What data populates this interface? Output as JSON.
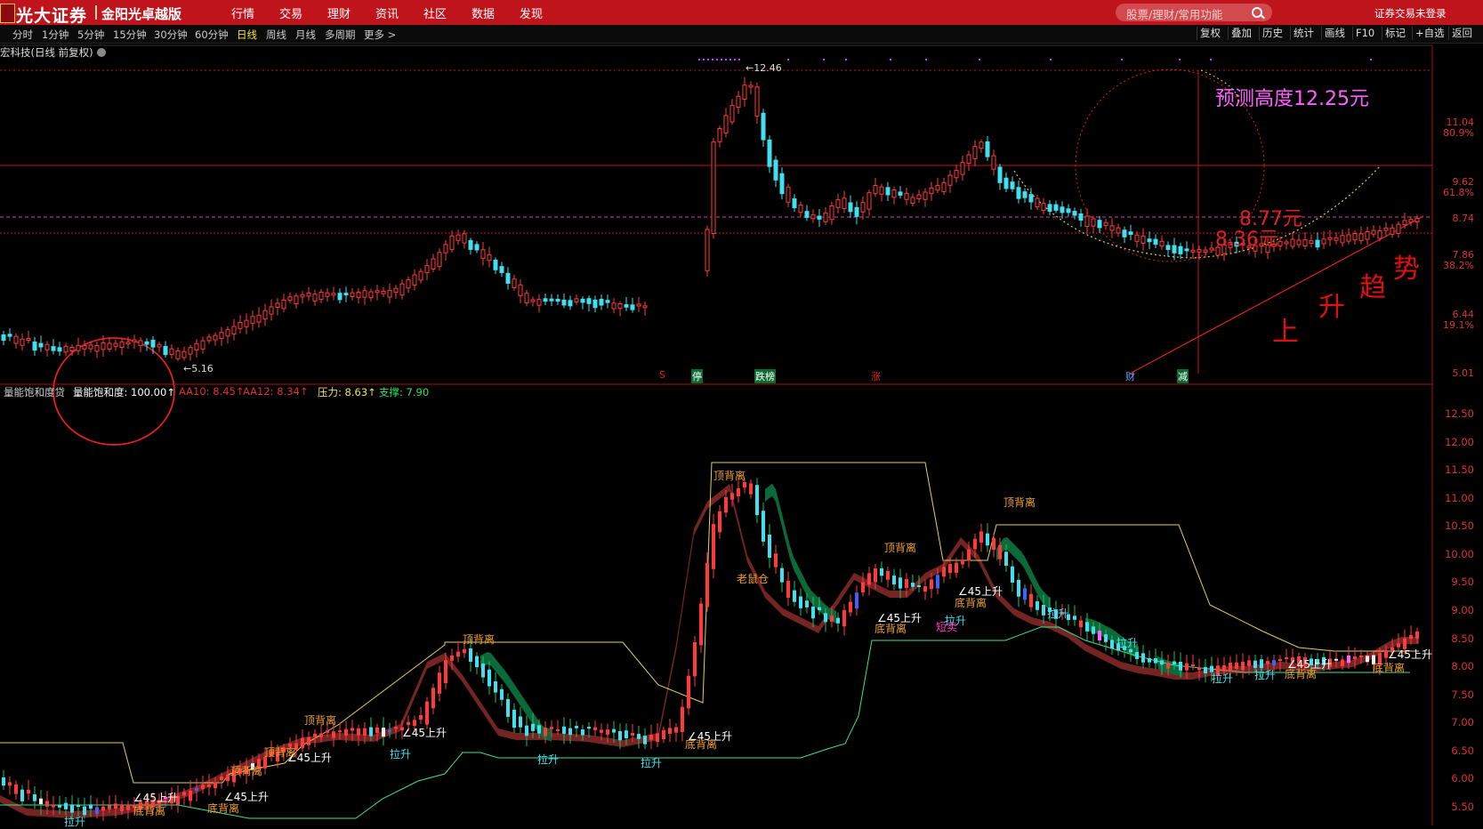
{
  "header": {
    "logo_text": "光大证券",
    "logo_subtitle": "金阳光卓越版",
    "menu": [
      "行情",
      "交易",
      "理财",
      "资讯",
      "社区",
      "数据",
      "发现"
    ],
    "search_placeholder": "股票/理财/常用功能",
    "login_status": "证券交易未登录"
  },
  "toolbar": {
    "periods": [
      "分时",
      "1分钟",
      "5分钟",
      "15分钟",
      "30分钟",
      "60分钟",
      "日线",
      "周线",
      "月线",
      "多周期",
      "更多 >"
    ],
    "active_period": "日线",
    "right_buttons": [
      "复权",
      "叠加",
      "历史",
      "统计",
      "画线",
      "F10",
      "标记",
      "+自选",
      "返回"
    ]
  },
  "stock": {
    "title": "宏科技(日线 前复权)"
  },
  "price_chart": {
    "axis_prices": [
      "11.04",
      "9.62",
      "8.74",
      "7.86",
      "6.44",
      "5.01"
    ],
    "axis_pcts": [
      "80.9%",
      "61.8%",
      "38.2%",
      "19.1%"
    ],
    "high_label": "12.46",
    "low_label": "5.16",
    "events": [
      "S",
      "停",
      "跌榜",
      "涨",
      "财",
      "减"
    ],
    "annotations": {
      "forecast": "预测高度12.25元",
      "level1": "8.77元",
      "level2": "8.36元",
      "trend_chars": [
        "上",
        "升",
        "趋",
        "势"
      ]
    }
  },
  "indicator": {
    "name": "量能饱和度贷",
    "items": [
      {
        "label": "量能饱和度: 100.00↑",
        "color": "#ffffff"
      },
      {
        "label": "AA10: 8.45↑",
        "color": "#e03030"
      },
      {
        "label": "AA12: 8.34↑",
        "color": "#e03030"
      },
      {
        "label": "压力: 8.63↑",
        "color": "#f0e060"
      },
      {
        "label": "支撑: 7.90",
        "color": "#30e060"
      }
    ],
    "axis": [
      "12.50",
      "12.00",
      "11.50",
      "11.00",
      "10.50",
      "10.00",
      "9.50",
      "9.00",
      "8.50",
      "8.00",
      "7.50",
      "7.00",
      "6.50",
      "6.00",
      "5.50"
    ],
    "labels": {
      "top_div": "顶背离",
      "bottom_div": "底背离",
      "rise45": "∠45上升",
      "pull_up": "拉升",
      "rat_warehouse": "老鼠仓",
      "short_sell": "短卖"
    }
  },
  "colors": {
    "up": "#ff3a3a",
    "down": "#40e0f0",
    "accent_red": "#c0141c",
    "forecast_pink": "#ff60ff"
  }
}
